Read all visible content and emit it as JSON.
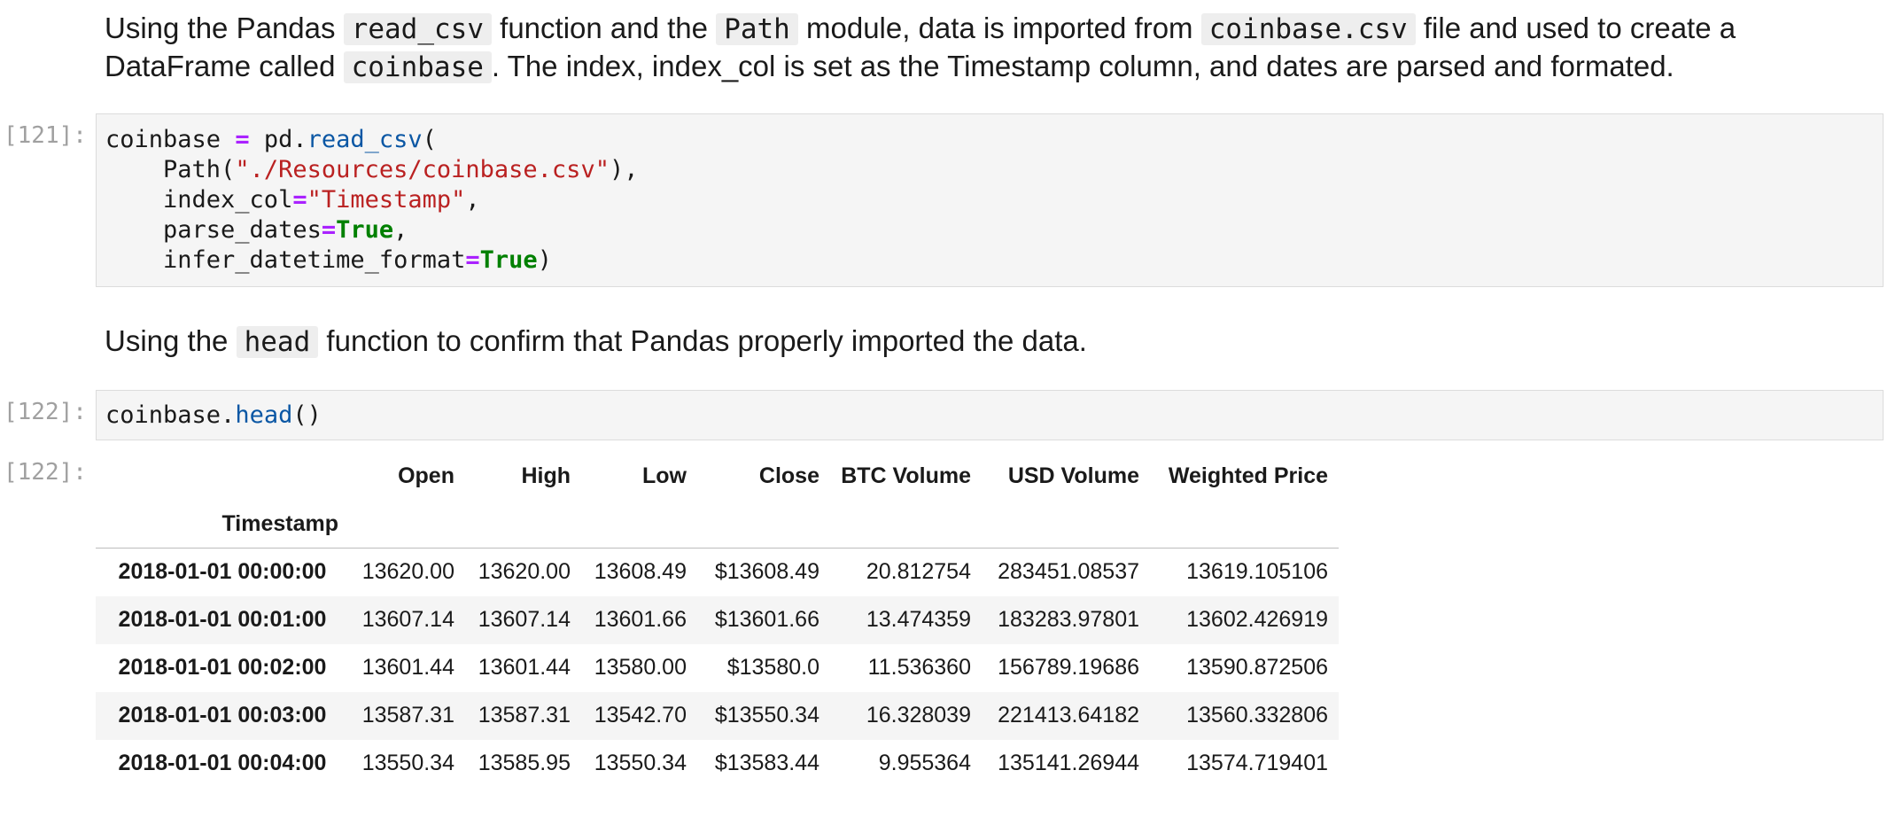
{
  "markdown1": {
    "t1": "Using the Pandas ",
    "c1": "read_csv",
    "t2": " function and the ",
    "c2": "Path",
    "t3": " module, data is imported from ",
    "c3": "coinbase.csv",
    "t4": " file and used to create a",
    "t5": "DataFrame called ",
    "c4": "coinbase",
    "t6": ". The index, index_col is set as the Timestamp column, and dates are parsed and formated."
  },
  "cell1": {
    "prompt": "[121]:",
    "l1_a": "coinbase ",
    "l1_op": "=",
    "l1_b": " pd.",
    "l1_fn": "read_csv",
    "l1_c": "(",
    "l2_a": "    Path(",
    "l2_str": "\"./Resources/coinbase.csv\"",
    "l2_b": "),",
    "l3_a": "    index_col",
    "l3_op": "=",
    "l3_str": "\"Timestamp\"",
    "l3_b": ",",
    "l4_a": "    parse_dates",
    "l4_op": "=",
    "l4_val": "True",
    "l4_b": ",",
    "l5_a": "    infer_datetime_format",
    "l5_op": "=",
    "l5_val": "True",
    "l5_b": ")"
  },
  "markdown2": {
    "t1": "Using the ",
    "c1": "head",
    "t2": " function to confirm that Pandas properly imported the data."
  },
  "cell2": {
    "prompt": "[122]:",
    "a": "coinbase.",
    "fn": "head",
    "b": "()"
  },
  "output": {
    "prompt": "[122]:",
    "columns": [
      "Open",
      "High",
      "Low",
      "Close",
      "BTC Volume",
      "USD Volume",
      "Weighted Price"
    ],
    "index_name": "Timestamp",
    "rows": [
      {
        "ts": "2018-01-01 00:00:00",
        "cells": [
          "13620.00",
          "13620.00",
          "13608.49",
          "$13608.49",
          "20.812754",
          "283451.08537",
          "13619.105106"
        ]
      },
      {
        "ts": "2018-01-01 00:01:00",
        "cells": [
          "13607.14",
          "13607.14",
          "13601.66",
          "$13601.66",
          "13.474359",
          "183283.97801",
          "13602.426919"
        ]
      },
      {
        "ts": "2018-01-01 00:02:00",
        "cells": [
          "13601.44",
          "13601.44",
          "13580.00",
          "$13580.0",
          "11.536360",
          "156789.19686",
          "13590.872506"
        ]
      },
      {
        "ts": "2018-01-01 00:03:00",
        "cells": [
          "13587.31",
          "13587.31",
          "13542.70",
          "$13550.34",
          "16.328039",
          "221413.64182",
          "13560.332806"
        ]
      },
      {
        "ts": "2018-01-01 00:04:00",
        "cells": [
          "13550.34",
          "13585.95",
          "13550.34",
          "$13583.44",
          "9.955364",
          "135141.26944",
          "13574.719401"
        ]
      }
    ]
  }
}
